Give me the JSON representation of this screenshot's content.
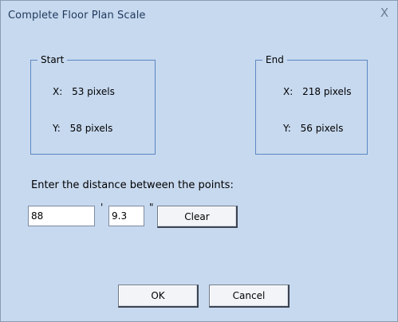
{
  "window": {
    "title": "Complete Floor Plan Scale",
    "close_glyph": "X"
  },
  "start": {
    "label": "Start",
    "x_label": "X:",
    "x_value": "53 pixels",
    "y_label": "Y:",
    "y_value": "58 pixels"
  },
  "end": {
    "label": "End",
    "x_label": "X:",
    "x_value": "218 pixels",
    "y_label": "Y:",
    "y_value": "56 pixels"
  },
  "distance": {
    "prompt": "Enter the distance between the points:",
    "feet_value": "88",
    "feet_unit": "'",
    "inches_value": "9.3",
    "inches_unit": "\"",
    "clear_label": "Clear"
  },
  "buttons": {
    "ok_label": "OK",
    "cancel_label": "Cancel"
  },
  "colors": {
    "dialog_background": "#c7d9ef",
    "group_border": "#5d87c0",
    "title_text": "#1e395b"
  }
}
